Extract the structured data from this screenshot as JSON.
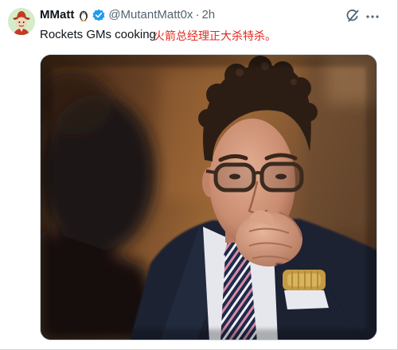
{
  "post": {
    "author": {
      "name": "MMatt",
      "avatar_icon": "avatar",
      "emoji_icon": "penguin-icon",
      "verified_icon": "verified-badge-icon",
      "handle": "@MutantMatt0x",
      "separator": "·",
      "time": "2h"
    },
    "actions": {
      "grok_icon": "grok-icon",
      "more_icon": "more-icon"
    },
    "text": "Rockets GMs cooking",
    "translation": "火箭总经理正大杀特杀。"
  },
  "colors": {
    "primary_text": "#0f1419",
    "secondary_text": "#536471",
    "verified": "#1d9bf0",
    "translation_text": "#e02b20"
  }
}
